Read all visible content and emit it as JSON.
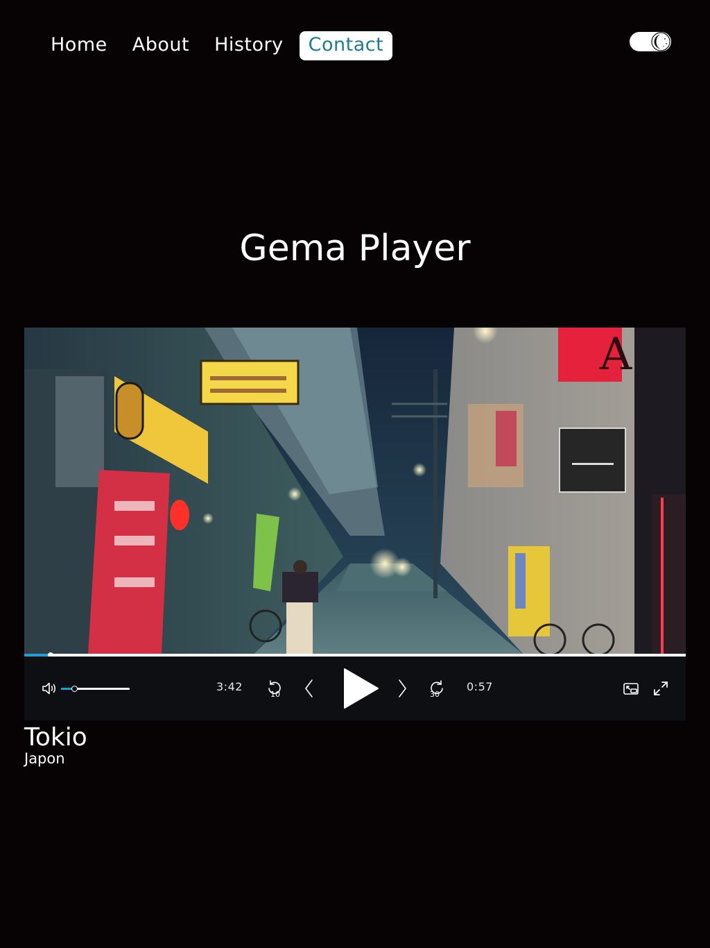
{
  "nav": {
    "items": [
      {
        "label": "Home"
      },
      {
        "label": "About"
      },
      {
        "label": "History"
      },
      {
        "label": "Contact",
        "active": true
      }
    ],
    "theme_toggle_icon": "moon-icon"
  },
  "page": {
    "title": "Gema Player"
  },
  "player": {
    "volume_icon": "volume-icon",
    "volume_level": 0.19,
    "progress_fraction": 0.04,
    "current_time": "3:42",
    "remaining_time": "0:57",
    "rewind_label": "10",
    "forward_label": "30",
    "controls": [
      "rewind-10-icon",
      "previous-icon",
      "play-icon",
      "next-icon",
      "forward-30-icon",
      "picture-in-picture-icon",
      "fullscreen-icon"
    ]
  },
  "video": {
    "title": "Tokio",
    "subtitle": "Japon"
  },
  "colors": {
    "background": "#070204",
    "accent": "#1d7c8f",
    "progress": "#1e9fd6",
    "controls_bg": "#0e0f12"
  }
}
